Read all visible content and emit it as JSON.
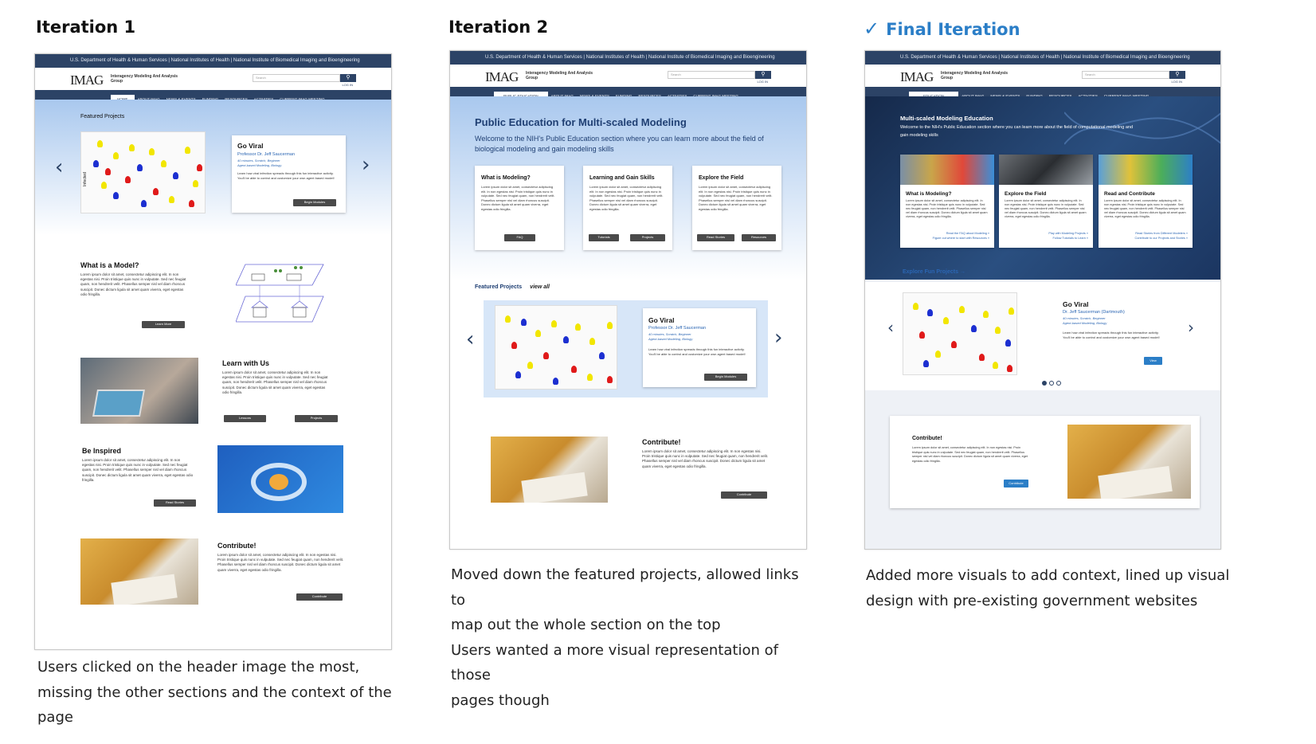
{
  "columns": [
    {
      "title": "Iteration 1",
      "caption": "Users clicked on the header image the most, missing the other sections and the context of the page",
      "gov_bar": "U.S. Department of Health & Human Services  |  National Institutes of Health  |  National Institute of Biomedical Imaging and Bioengineering",
      "logo": "IMAG",
      "logo_sub": "Interagency Modeling And Analysis Group",
      "search_placeholder": "Search",
      "login": "LOG IN",
      "nav": [
        "HOME",
        "ABOUT IMAG",
        "NEWS & EVENTS",
        "FUNDING",
        "RESOURCES",
        "ACTIVITIES",
        "CURRENT IMAG MEETING"
      ],
      "featured_label": "Featured Projects",
      "featured": {
        "title": "Go Viral",
        "author": "Professor Dr. Jeff Saucerman",
        "meta": "40 minutes, Scratch, Beginner",
        "meta2": "Agent-based Modeling, Biology",
        "desc": "Learn how viral infection spreads through this fun interactive activity. You'll be able to control and customize your own agent based model!",
        "button": "Begin Modules",
        "y_axis": "Infected"
      },
      "sections": [
        {
          "title": "What is a Model?",
          "button": "Learn More"
        },
        {
          "title": "Learn with Us",
          "buttons": [
            "Lessons",
            "Projects"
          ]
        },
        {
          "title": "Be Inspired",
          "button": "Read Stories"
        },
        {
          "title": "Contribute!",
          "button": "Contribute"
        }
      ],
      "lorem": "Lorem ipsum dolor sit amet, consectetur adipiscing elit. In non egestas nisi. Proin tristique quis nunc in vulputate. Sed nec feugiat quam, non hendrerit velit. Phasellus semper nisl vel diam rhoncus suscipit. Donec dictum ligula sit amet quam viverra, eget egestas odio fringilla."
    },
    {
      "title": "Iteration 2",
      "caption_lines": [
        "Moved down the featured projects, allowed links to",
        "map out the whole section on the top",
        "Users wanted a more visual representation of those",
        "pages though"
      ],
      "hero_title": "Public Education for Multi-scaled Modeling",
      "hero_text": "Welcome to the NIH's Public Education section where you can learn more about the field of biological modeling and gain modeling skills",
      "nav_active": "PUBLIC EDUCATION",
      "cards": [
        {
          "title": "What is Modeling?",
          "buttons": [
            "FAQ"
          ]
        },
        {
          "title": "Learning and Gain Skills",
          "buttons": [
            "Tutorials",
            "Projects"
          ]
        },
        {
          "title": "Explore the Field",
          "buttons": [
            "Read Stories",
            "Resources"
          ]
        }
      ],
      "featured_label": "Featured Projects",
      "view_all": "view all",
      "featured": {
        "title": "Go Viral",
        "author": "Professor Dr. Jeff Saucerman",
        "meta": "40 minutes, Scratch, Beginner",
        "meta2": "Agent-based Modeling, Biology",
        "button": "Begin Modules"
      },
      "contribute": {
        "title": "Contribute!",
        "button": "Contribute"
      }
    },
    {
      "title": "Final Iteration",
      "caption_lines": [
        "Added more visuals to add context, lined up visual",
        "design with pre-existing government websites"
      ],
      "nav_active": "EDUCATION",
      "hero_title": "Multi-scaled Modeling Education",
      "hero_text": "Welcome to the NIH's Public Education section where you can learn more about the field of computational modeling and gain modeling skills",
      "cards": [
        {
          "title": "What is Modeling?",
          "links": [
            "Read the FAQ about Modeling »",
            "Figure out where to start with Resources »"
          ]
        },
        {
          "title": "Explore the Field",
          "links": [
            "Play with Modeling Projects »",
            "Follow Tutorials to Learn »"
          ]
        },
        {
          "title": "Read and Contribute",
          "links": [
            "Read Stories from Different Modelers »",
            "Contribute to our Projects and Stories »"
          ]
        }
      ],
      "explore_link": "Explore Fun Projects  →",
      "featured": {
        "title": "Go Viral",
        "author": "Dr. Jeff Saucerman (Dartmouth)",
        "meta": "40 minutes, Scratch, Beginner",
        "meta2": "Agent-based Modeling, Biology",
        "button": "View"
      },
      "contribute": {
        "title": "Contribute!",
        "button": "Contribute"
      }
    }
  ]
}
